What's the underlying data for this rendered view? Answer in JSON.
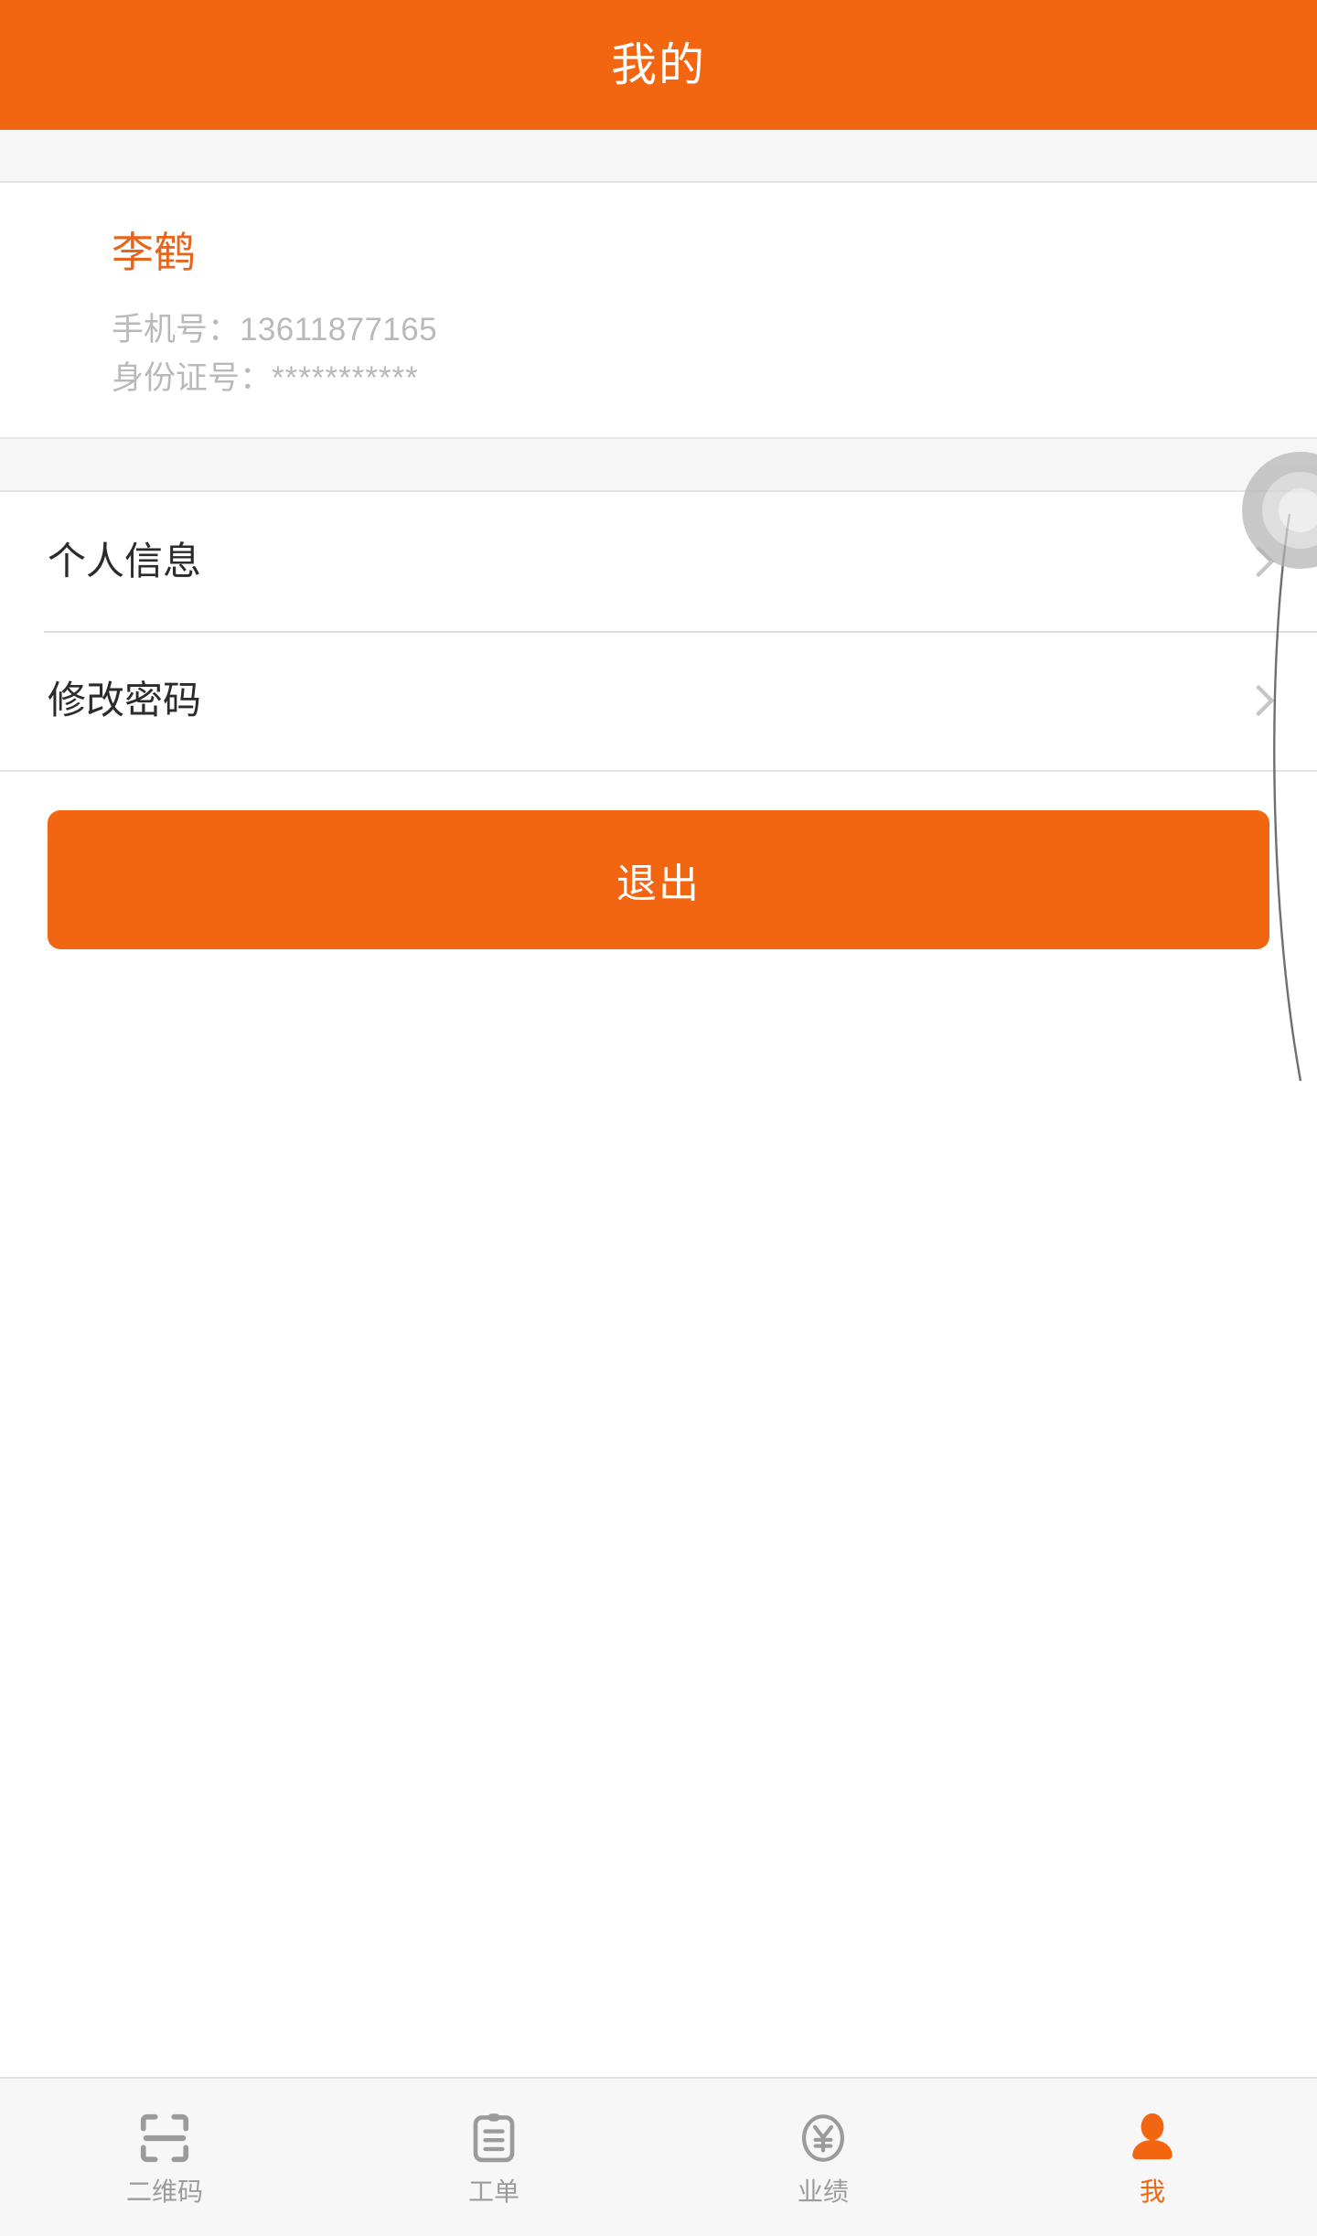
{
  "header": {
    "title": "我的"
  },
  "profile": {
    "name": "李鹤",
    "phone_label": "手机号：",
    "phone_value": "13611877165",
    "id_label": "身份证号：",
    "id_value": "***********"
  },
  "menu": {
    "items": [
      {
        "label": "个人信息",
        "chevron": "chevron-right-icon"
      },
      {
        "label": "修改密码",
        "chevron": "chevron-right-icon"
      }
    ]
  },
  "actions": {
    "logout_label": "退出"
  },
  "tabbar": {
    "items": [
      {
        "label": "二维码",
        "icon": "qr-scan-icon",
        "active": false
      },
      {
        "label": "工单",
        "icon": "clipboard-icon",
        "active": false
      },
      {
        "label": "业绩",
        "icon": "yen-circle-icon",
        "active": false
      },
      {
        "label": "我",
        "icon": "person-icon",
        "active": true
      }
    ]
  },
  "colors": {
    "accent": "#F26511",
    "name_text": "#E8641B",
    "muted_text": "#b9b9b9",
    "primary_text": "#2b2b2b",
    "tab_inactive": "#9b9b9b",
    "divider": "#dcdcdc",
    "band": "#f6f6f6"
  }
}
